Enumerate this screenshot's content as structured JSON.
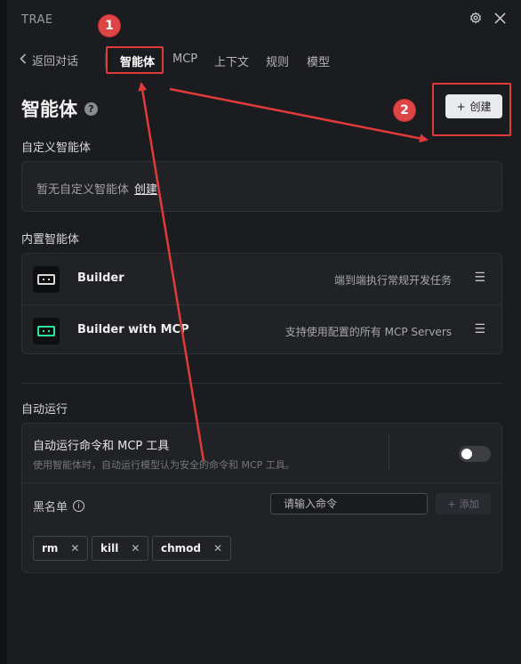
{
  "app": {
    "title": "TRAE"
  },
  "topbar": {
    "settings_icon": "gear-icon",
    "close_icon": "close-icon"
  },
  "nav": {
    "back_label": "返回对话",
    "tabs": [
      {
        "label": "智能体",
        "active": true
      },
      {
        "label": "MCP",
        "active": false
      },
      {
        "label": "上下文",
        "active": false
      },
      {
        "label": "规则",
        "active": false
      },
      {
        "label": "模型",
        "active": false
      }
    ]
  },
  "header": {
    "title": "智能体",
    "help_glyph": "?",
    "create_button": {
      "icon": "+",
      "label": "创建"
    }
  },
  "custom_agents": {
    "section_label": "自定义智能体",
    "empty_text": "暂无自定义智能体",
    "create_link": "创建"
  },
  "builtin_agents": {
    "section_label": "内置智能体",
    "items": [
      {
        "name": "Builder",
        "description": "端到端执行常规开发任务",
        "icon": "builder-icon"
      },
      {
        "name": "Builder with MCP",
        "description": "支持使用配置的所有 MCP Servers",
        "icon": "builder-mcp-icon"
      }
    ]
  },
  "auto_run": {
    "section_label": "自动运行",
    "title": "自动运行命令和 MCP 工具",
    "subtitle": "使用智能体时，自动运行模型认为安全的命令和 MCP 工具。",
    "enabled": false,
    "blacklist": {
      "label": "黑名单",
      "info_glyph": "i",
      "input_placeholder": "请输入命令",
      "input_value": "",
      "add_icon": "+",
      "add_label": "添加",
      "items": [
        "rm",
        "kill",
        "chmod"
      ],
      "remove_glyph": "✕"
    }
  },
  "annotations": {
    "step1": "1",
    "step2": "2",
    "color": "#e03a3a"
  }
}
